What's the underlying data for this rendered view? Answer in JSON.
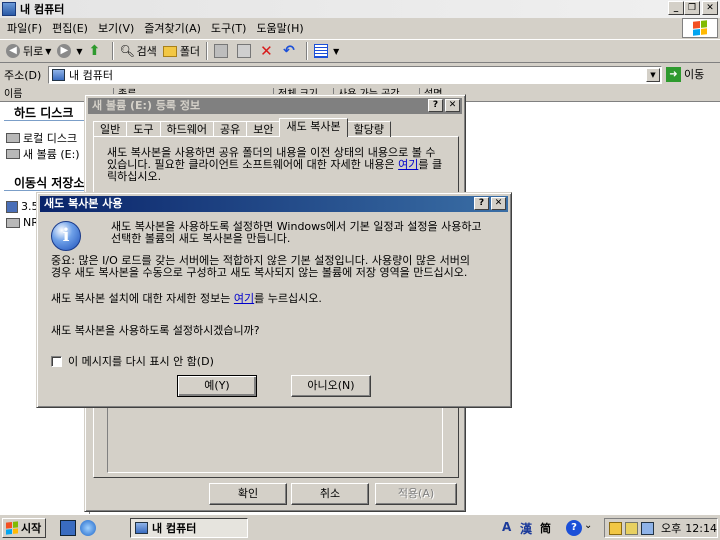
{
  "explorer": {
    "title": "내 컴퓨터",
    "menu": [
      "파일(F)",
      "편집(E)",
      "보기(V)",
      "즐겨찾기(A)",
      "도구(T)",
      "도움말(H)"
    ],
    "toolbar": {
      "back": "뒤로",
      "search": "검색",
      "folders": "폴더"
    },
    "address_label": "주소(D)",
    "address_value": "내 컴퓨터",
    "go_label": "이동",
    "columns": [
      "이름",
      "종류",
      "전체 크기",
      "사용 가능 공간",
      "설명"
    ],
    "groups": {
      "hard_disk": "하드 디스크",
      "removable": "이동식 저장소"
    },
    "items": [
      "로컬 디스크",
      "새 볼륨 (E:)",
      "3.5",
      "NR"
    ]
  },
  "props": {
    "title": "새 볼륨 (E:) 등록 정보",
    "tabs": [
      "일반",
      "도구",
      "하드웨어",
      "공유",
      "보안",
      "새도 복사본",
      "할당량"
    ],
    "active_tab": "새도 복사본",
    "desc_1": "새도 복사본을 사용하면 공유 폴더의 내용을 이전 상태의 내용으로 볼 수 있습니다. 필요한 클라이언트 소프트웨어에 대한 자세한 내용은",
    "desc_link": "여기",
    "desc_2": "를 클릭하십시오.",
    "ok": "확인",
    "cancel": "취소",
    "apply": "적용(A)"
  },
  "confirm": {
    "title": "새도 복사본 사용",
    "line1": "새도 복사본을 사용하도록 설정하면 Windows에서 기본 일정과 설정을 사용하고",
    "line2": "선택한 볼륨의 새도 복사본을 만듭니다.",
    "warn1": "중요: 많은 I/O 로드를 갖는 서버에는 적합하지 않은 기본 설정입니다. 사용량이 많은 서버의",
    "warn2": "경우 새도 복사본을 수동으로 구성하고 새도 복사되지 않는 볼륨에 저장 영역을 만드십시오.",
    "info_pre": "새도 복사본 설치에 대한 자세한 정보는 ",
    "info_link": "여기",
    "info_post": "를 누르십시오.",
    "question": "새도 복사본을 사용하도록 설정하시겠습니까?",
    "checkbox": "이 메시지를 다시 표시 안 함(D)",
    "yes": "예(Y)",
    "no": "아니오(N)"
  },
  "taskbar": {
    "start": "시작",
    "task": "내 컴퓨터",
    "ime_a": "A",
    "ime_han": "漢",
    "ime_char": "简",
    "ampm": "오후",
    "time": "12:14"
  },
  "colors": {
    "title_active": "#0a246a",
    "title_inactive": "#808080",
    "face": "#d4d0c8",
    "link": "#0000cc"
  },
  "icons": [
    "back-icon",
    "forward-icon",
    "up-folder-icon",
    "search-icon",
    "folders-icon",
    "move-icon",
    "copy-icon",
    "delete-icon",
    "undo-icon",
    "views-icon",
    "drive-icon",
    "info-icon",
    "help-icon",
    "windows-flag-icon"
  ]
}
